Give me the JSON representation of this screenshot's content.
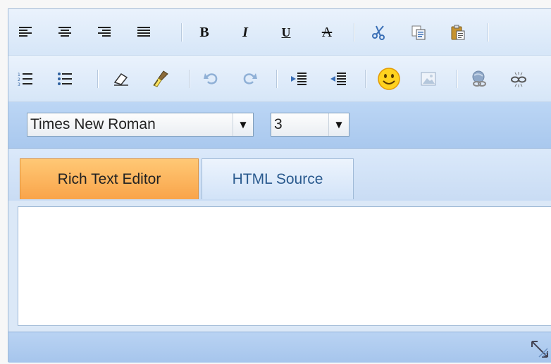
{
  "toolbar_row1": {
    "buttons": [
      {
        "name": "align-left-icon"
      },
      {
        "name": "align-center-icon"
      },
      {
        "name": "align-right-icon"
      },
      {
        "name": "align-justify-icon"
      },
      {
        "name": "bold-icon",
        "glyph": "B"
      },
      {
        "name": "italic-icon",
        "glyph": "I"
      },
      {
        "name": "underline-icon",
        "glyph": "U"
      },
      {
        "name": "strikethrough-icon",
        "glyph": "A"
      },
      {
        "name": "cut-icon"
      },
      {
        "name": "copy-icon"
      },
      {
        "name": "paste-icon"
      }
    ]
  },
  "toolbar_row2": {
    "buttons": [
      {
        "name": "ordered-list-icon"
      },
      {
        "name": "unordered-list-icon"
      },
      {
        "name": "eraser-icon"
      },
      {
        "name": "clean-format-brush-icon"
      },
      {
        "name": "undo-icon"
      },
      {
        "name": "redo-icon"
      },
      {
        "name": "indent-icon"
      },
      {
        "name": "outdent-icon"
      },
      {
        "name": "smiley-icon"
      },
      {
        "name": "image-icon"
      },
      {
        "name": "link-icon"
      },
      {
        "name": "unlink-icon"
      }
    ]
  },
  "fontbar": {
    "font_family": "Times New Roman",
    "font_size": "3"
  },
  "tabs": [
    {
      "label": "Rich Text Editor",
      "active": true
    },
    {
      "label": "HTML Source",
      "active": false
    }
  ],
  "colors": {
    "toolbar_bg": "#dce9f8",
    "active_tab": "#f9a44a",
    "border": "#9fb9d6"
  }
}
